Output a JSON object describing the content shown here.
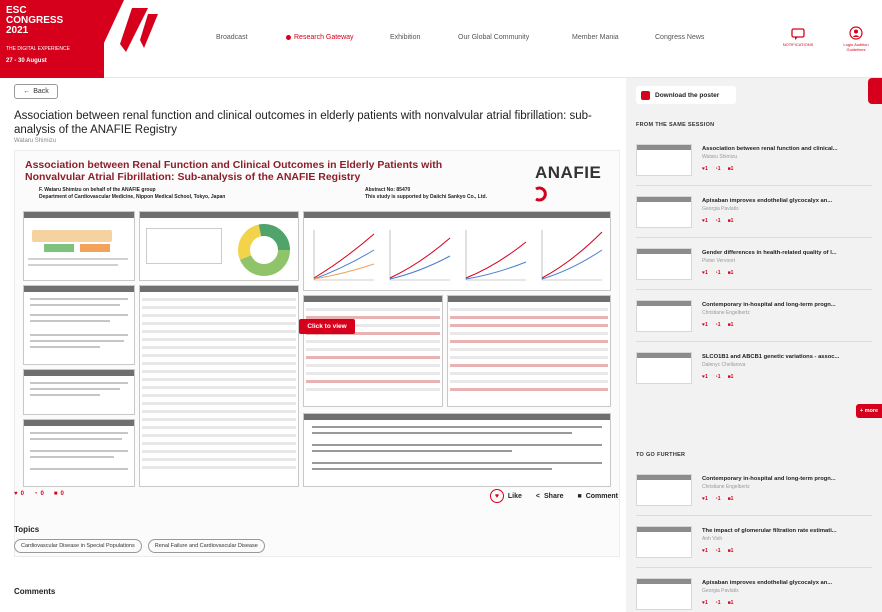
{
  "header": {
    "logo": {
      "line1": "ESC",
      "line2": "CONGRESS",
      "line3": "2021",
      "subtitle": "THE DIGITAL EXPERIENCE",
      "dates": "27 - 30 August"
    },
    "nav": [
      {
        "label": "Broadcast"
      },
      {
        "label": "Research Gateway",
        "active": true
      },
      {
        "label": "Exhibition"
      },
      {
        "label": "Our Global Community"
      },
      {
        "label": "Member Mania"
      },
      {
        "label": "Congress News"
      }
    ],
    "icons": [
      {
        "name": "chat-icon",
        "label": "NOTIFICATIONS"
      },
      {
        "name": "user-icon",
        "label": "Login Audition Guidelines"
      }
    ]
  },
  "main": {
    "back_label": "Back",
    "title": "Association between renal function and clinical outcomes in elderly patients with nonvalvular atrial fibrillation: sub-analysis of the ANAFIE Registry",
    "author": "Wataru Shimizu",
    "poster": {
      "title": "Association between Renal Function and Clinical Outcomes in Elderly Patients with Nonvalvular Atrial Fibrillation: Sub-analysis of the ANAFIE Registry",
      "authors_line1": "F. Wataru Shimizu on behalf of the ANAFIE group",
      "authors_line2": "Department of Cardiovascular Medicine, Nippon Medical School, Tokyo, Japan",
      "abstract": "Abstract No: 85470",
      "support": "This study is supported by Daiichi Sankyo Co., Ltd.",
      "logo": "ANAFIE",
      "click_label": "Click to view"
    },
    "stats": {
      "likes": "0",
      "comments": "0",
      "saves": "0"
    },
    "actions": {
      "like": "Like",
      "share": "Share",
      "comment": "Comment"
    },
    "topics_heading": "Topics",
    "topics": [
      "Cardiovascular Disease in Special Populations",
      "Renal Failure and Cardiovascular Disease"
    ],
    "comments_heading": "Comments"
  },
  "sidebar": {
    "download_label": "Download the poster",
    "same_session_heading": "FROM THE SAME SESSION",
    "same_session": [
      {
        "title": "Association between renal function and clinical...",
        "author": "Wataru Shimizu",
        "likes": "1",
        "comments": "1",
        "saves": "1"
      },
      {
        "title": "Apixaban improves endothelial glycocalyx an...",
        "author": "Georgia Pavlatis",
        "likes": "1",
        "comments": "1",
        "saves": "1"
      },
      {
        "title": "Gender differences in health-related quality of l...",
        "author": "Pieter Vervoort",
        "likes": "1",
        "comments": "1",
        "saves": "1"
      },
      {
        "title": "Contemporary in-hospital and long-term progn...",
        "author": "Christiane Engelbertz",
        "likes": "1",
        "comments": "1",
        "saves": "1"
      },
      {
        "title": "SLCO1B1 and ABCB1 genetic variations - assoc...",
        "author": "Dalenyc Chellarova",
        "likes": "1",
        "comments": "1",
        "saves": "1"
      }
    ],
    "more_label": "+ more",
    "go_further_heading": "TO GO FURTHER",
    "go_further": [
      {
        "title": "Contemporary in-hospital and long-term progn...",
        "author": "Christiane Engelbertz",
        "likes": "1",
        "comments": "1",
        "saves": "1"
      },
      {
        "title": "The impact of glomerular filtration rate estimati...",
        "author": "Anh Vinh",
        "likes": "1",
        "comments": "1",
        "saves": "1"
      },
      {
        "title": "Apixaban improves endothelial glycocalyx an...",
        "author": "Georgia Pavlatis",
        "likes": "1",
        "comments": "1",
        "saves": "1"
      }
    ]
  },
  "colors": {
    "brand": "#d6001c",
    "poster_title": "#8c1f2a",
    "sidebar_bg": "#f2f2f2"
  }
}
